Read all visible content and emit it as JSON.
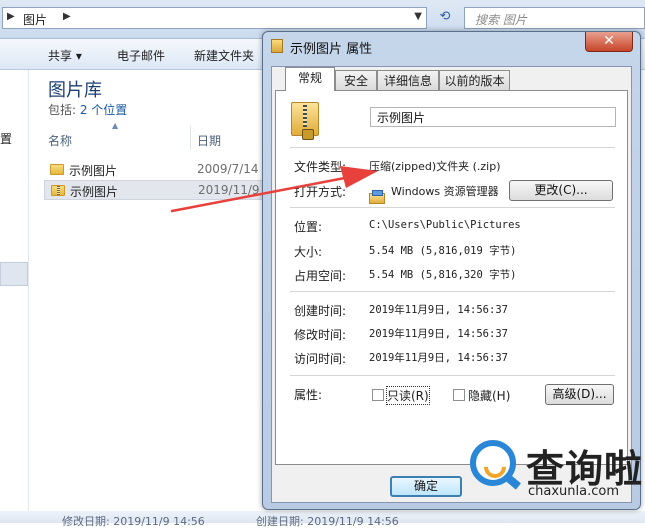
{
  "explorer": {
    "address": "图片",
    "search_placeholder": "搜索 图片",
    "toolbar": [
      "共享 ▾",
      "电子邮件",
      "新建文件夹"
    ],
    "nav_glyph": "置",
    "library_title": "图片库",
    "include_prefix": "包括: ",
    "include_link": "2 个位置",
    "col_name": "名称",
    "col_date": "日期",
    "files": [
      {
        "name": "示例图片",
        "date": "2009/7/14"
      },
      {
        "name": "示例图片",
        "date": "2019/11/9"
      }
    ],
    "status_modified": "修改日期: 2019/11/9 14:56",
    "status_created": "创建日期: 2019/11/9 14:56"
  },
  "dialog": {
    "title": "示例图片 属性",
    "close": "✕",
    "tabs": [
      "常规",
      "安全",
      "详细信息",
      "以前的版本"
    ],
    "file_name": "示例图片",
    "rows": {
      "type_label": "文件类型:",
      "type_value": "压缩(zipped)文件夹 (.zip)",
      "open_label": "打开方式:",
      "open_value": "Windows 资源管理器",
      "change_btn": "更改(C)...",
      "location_label": "位置:",
      "location_value": "C:\\Users\\Public\\Pictures",
      "size_label": "大小:",
      "size_value": "5.54 MB (5,816,019 字节)",
      "disk_label": "占用空间:",
      "disk_value": "5.54 MB (5,816,320 字节)",
      "created_label": "创建时间:",
      "created_value": "2019年11月9日, 14:56:37",
      "modified_label": "修改时间:",
      "modified_value": "2019年11月9日, 14:56:37",
      "accessed_label": "访问时间:",
      "accessed_value": "2019年11月9日, 14:56:37",
      "attr_label": "属性:",
      "readonly": "只读(R)",
      "hidden": "隐藏(H)",
      "advanced_btn": "高级(D)..."
    },
    "ok_btn": "确定"
  },
  "watermark": {
    "name": "查询啦",
    "url": "chaxunla.com"
  },
  "colors": {
    "arrow": "#e8403a",
    "accent": "#2a86d6"
  }
}
